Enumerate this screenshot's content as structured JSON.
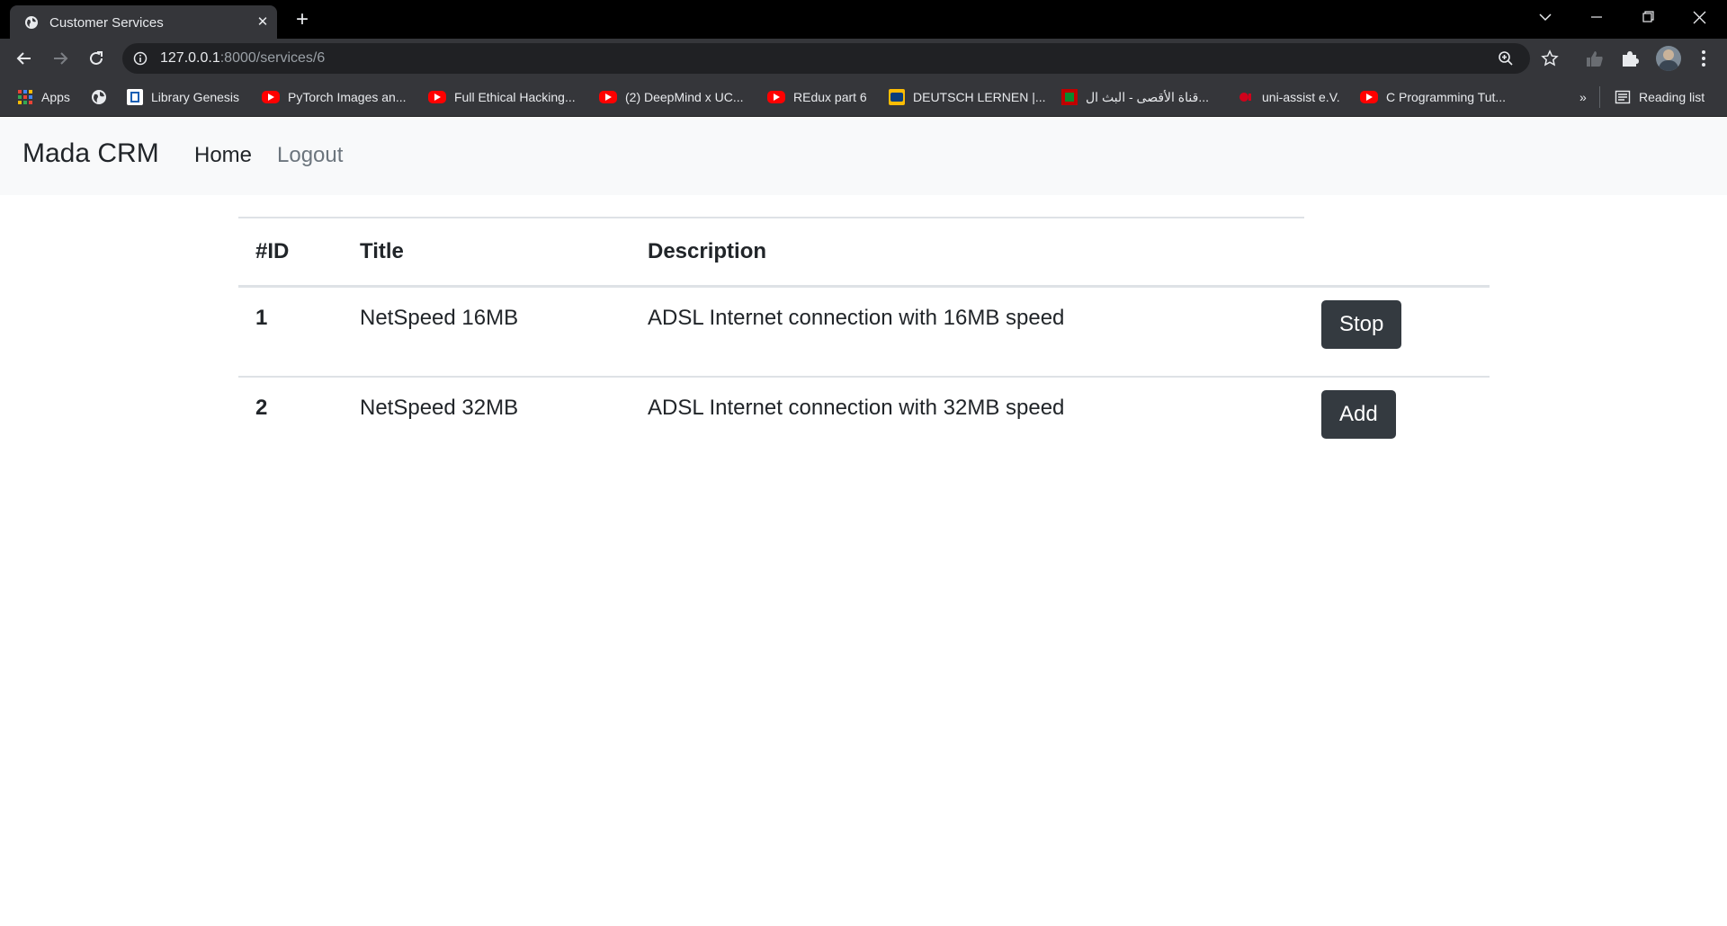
{
  "browser": {
    "tab_title": "Customer Services",
    "url_host": "127.0.0.1",
    "url_path": ":8000/services/6",
    "bookmarks": [
      {
        "label": "Apps",
        "icon": "apps-grid-icon"
      },
      {
        "label": "",
        "icon": "globe-icon"
      },
      {
        "label": "Library Genesis",
        "icon": "library-icon"
      },
      {
        "label": "PyTorch Images an...",
        "icon": "youtube-icon"
      },
      {
        "label": "Full Ethical Hacking...",
        "icon": "youtube-icon"
      },
      {
        "label": "(2) DeepMind x UC...",
        "icon": "youtube-icon"
      },
      {
        "label": "REdux part 6",
        "icon": "youtube-icon"
      },
      {
        "label": "DEUTSCH LERNEN |...",
        "icon": "dw-icon"
      },
      {
        "label": "قناة الأقصى - البث ال...",
        "icon": "aqsa-icon"
      },
      {
        "label": "uni-assist e.V.",
        "icon": "uni-assist-icon"
      },
      {
        "label": "C Programming Tut...",
        "icon": "youtube-icon"
      }
    ],
    "overflow_label": "»",
    "reading_list_label": "Reading list"
  },
  "navbar": {
    "brand": "Mada CRM",
    "links": [
      {
        "label": "Home"
      },
      {
        "label": "Logout"
      }
    ]
  },
  "table": {
    "headers": [
      "#ID",
      "Title",
      "Description"
    ],
    "rows": [
      {
        "id": "1",
        "title": "NetSpeed 16MB",
        "description": "ADSL Internet connection with 16MB speed",
        "action": "Stop"
      },
      {
        "id": "2",
        "title": "NetSpeed 32MB",
        "description": "ADSL Internet connection with 32MB speed",
        "action": "Add"
      }
    ]
  },
  "colors": {
    "chrome_dark": "#35363a",
    "navbar_bg": "#f8f9fa",
    "button_dark": "#343a40",
    "text": "#212529",
    "muted_link": "#6c757d"
  }
}
